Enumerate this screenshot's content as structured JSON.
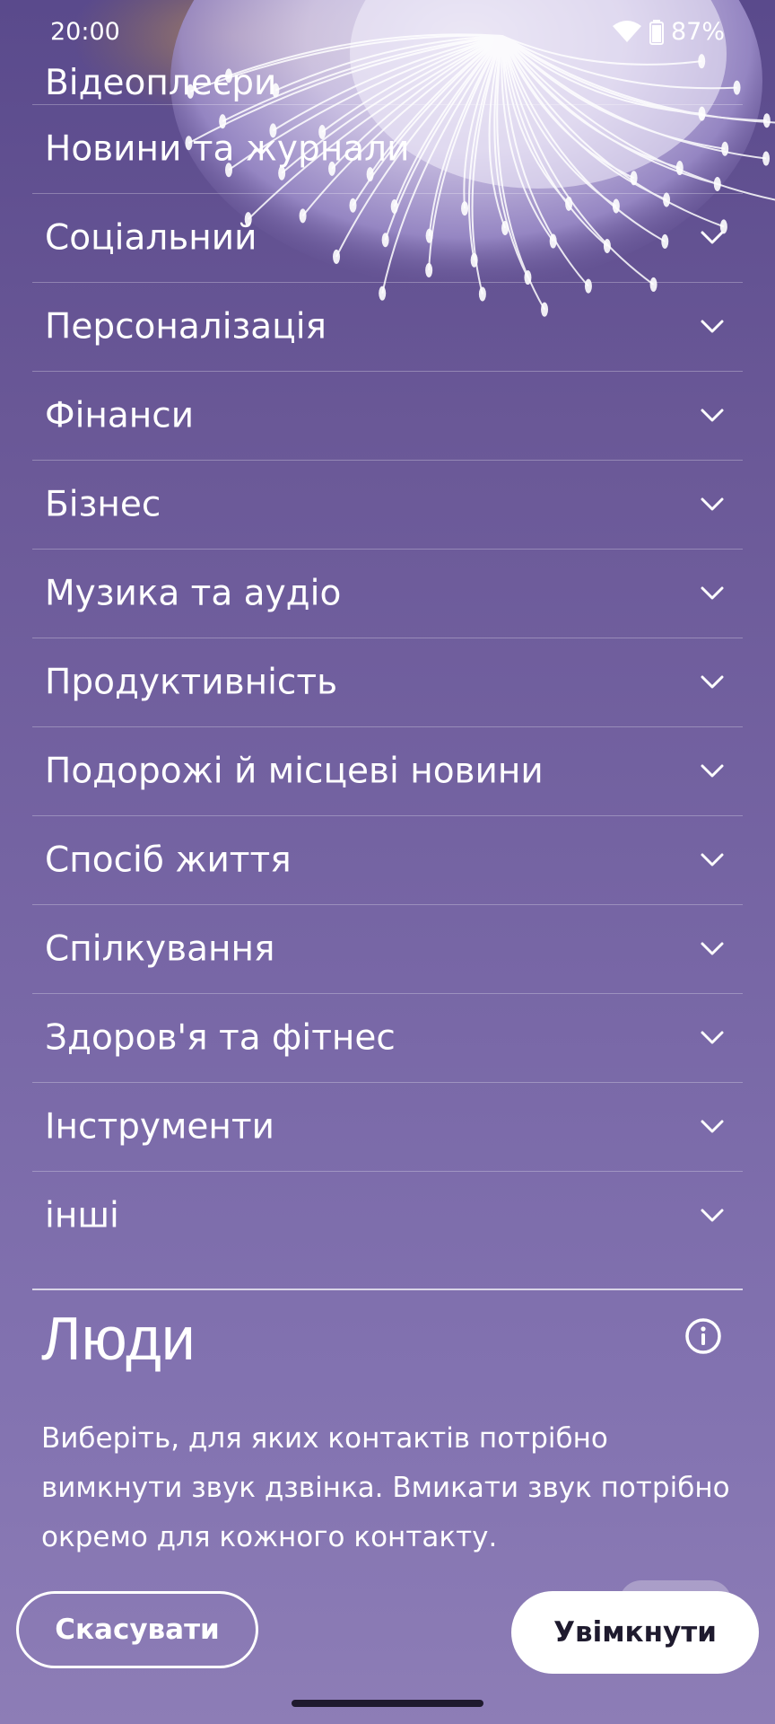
{
  "status_bar": {
    "time": "20:00",
    "battery": "87%",
    "icons": [
      "wifi-icon",
      "battery-icon"
    ]
  },
  "categories": [
    {
      "label": "Відеоплеєри"
    },
    {
      "label": "Новини та журнали"
    },
    {
      "label": "Соціальний"
    },
    {
      "label": "Персоналізація"
    },
    {
      "label": "Фінанси"
    },
    {
      "label": "Бізнес"
    },
    {
      "label": "Музика та аудіо"
    },
    {
      "label": "Продуктивність"
    },
    {
      "label": "Подорожі й місцеві новини"
    },
    {
      "label": "Спосіб життя"
    },
    {
      "label": "Спілкування"
    },
    {
      "label": "Здоров'я та фітнес"
    },
    {
      "label": "Інструменти"
    },
    {
      "label": "інші"
    }
  ],
  "people": {
    "title": "Люди",
    "description": "Виберіть, для яких контактів потрібно вимкнути звук дзвінка. Вмикати звук потрібно окремо для кожного контакту."
  },
  "actions": {
    "cancel_label": "Скасувати",
    "enable_label": "Увімкнути"
  },
  "colors": {
    "background_top": "#5a4a8c",
    "background_bottom": "#8d7db6",
    "primary_button_bg": "#ffffff",
    "primary_button_text": "#1e1a2e"
  }
}
